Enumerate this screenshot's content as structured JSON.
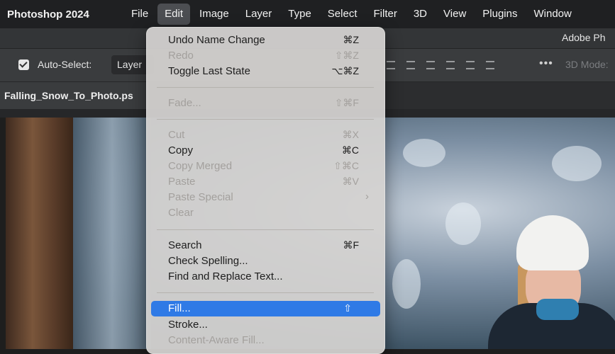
{
  "menubar": {
    "app_name": "Photoshop 2024",
    "items": [
      "File",
      "Edit",
      "Image",
      "Layer",
      "Type",
      "Select",
      "Filter",
      "3D",
      "View",
      "Plugins",
      "Window"
    ]
  },
  "title_strip": {
    "app_title": "Adobe Ph"
  },
  "options_bar": {
    "auto_select_label": "Auto-Select:",
    "auto_select_checked": true,
    "layer_select_value": "Layer",
    "more_label": "•••",
    "mode_3d_label": "3D Mode:"
  },
  "document_tab": {
    "name": "Falling_Snow_To_Photo.ps"
  },
  "edit_menu": {
    "undo": {
      "label": "Undo Name Change",
      "shortcut": "⌘Z"
    },
    "redo": {
      "label": "Redo",
      "shortcut": "⇧⌘Z"
    },
    "toggle": {
      "label": "Toggle Last State",
      "shortcut": "⌥⌘Z"
    },
    "fade": {
      "label": "Fade...",
      "shortcut": "⇧⌘F"
    },
    "cut": {
      "label": "Cut",
      "shortcut": "⌘X"
    },
    "copy": {
      "label": "Copy",
      "shortcut": "⌘C"
    },
    "copy_merged": {
      "label": "Copy Merged",
      "shortcut": "⇧⌘C"
    },
    "paste": {
      "label": "Paste",
      "shortcut": "⌘V"
    },
    "paste_special": {
      "label": "Paste Special",
      "submenu": "›"
    },
    "clear": {
      "label": "Clear"
    },
    "search": {
      "label": "Search",
      "shortcut": "⌘F"
    },
    "check_spelling": {
      "label": "Check Spelling..."
    },
    "find_replace": {
      "label": "Find and Replace Text..."
    },
    "fill": {
      "label": "Fill...",
      "shortcut": "⇧"
    },
    "stroke": {
      "label": "Stroke..."
    },
    "content_aware_fill": {
      "label": "Content-Aware Fill..."
    }
  },
  "colors": {
    "highlight": "#2f7ae6",
    "menubar_bg": "#1f2022"
  }
}
